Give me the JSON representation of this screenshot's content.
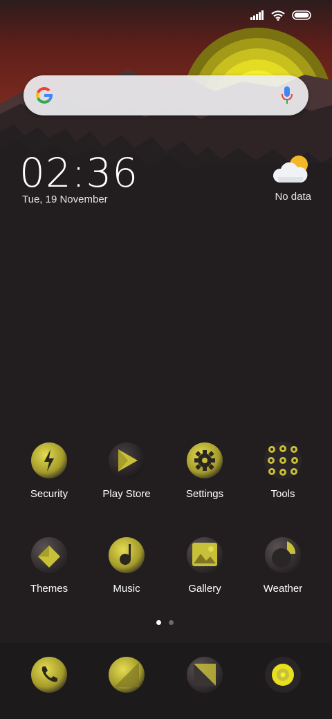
{
  "colors": {
    "background": "#221e20",
    "sky": "#6a201a",
    "sun_accent": "#e8e01e",
    "icon_accent": "#c9c03a"
  },
  "status_bar": {
    "icons": [
      "signal-icon",
      "wifi-icon",
      "battery-icon"
    ]
  },
  "search": {
    "logo": "google-logo",
    "mic_icon": "mic-icon"
  },
  "clock": {
    "time": "02:36",
    "date": "Tue, 19 November"
  },
  "weather": {
    "icon": "partly-cloudy-icon",
    "status": "No data"
  },
  "apps_row1": [
    {
      "label": "Security",
      "icon": "security-bolt-icon"
    },
    {
      "label": "Play Store",
      "icon": "play-store-icon"
    },
    {
      "label": "Settings",
      "icon": "settings-gear-icon"
    },
    {
      "label": "Tools",
      "icon": "tools-folder-icon"
    }
  ],
  "apps_row2": [
    {
      "label": "Themes",
      "icon": "themes-icon"
    },
    {
      "label": "Music",
      "icon": "music-note-icon"
    },
    {
      "label": "Gallery",
      "icon": "gallery-icon"
    },
    {
      "label": "Weather",
      "icon": "weather-app-icon"
    }
  ],
  "pagination": {
    "pages": 2,
    "current": 1
  },
  "dock": [
    {
      "icon": "phone-icon"
    },
    {
      "icon": "messages-icon"
    },
    {
      "icon": "camera-icon"
    },
    {
      "icon": "browser-icon"
    }
  ]
}
